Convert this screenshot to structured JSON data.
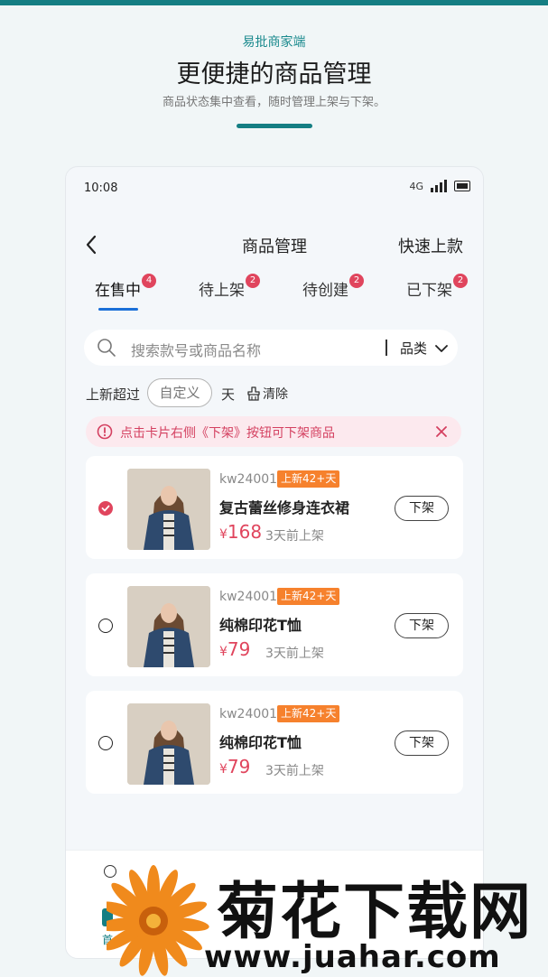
{
  "promo": {
    "brand": "易批商家端",
    "headline": "更便捷的商品管理",
    "subtext": "商品状态集中查看，随时管理上架与下架。"
  },
  "status_bar": {
    "time": "10:08",
    "network": "4G"
  },
  "nav": {
    "title": "商品管理",
    "action": "快速上款",
    "back_icon": "chevron-left-icon"
  },
  "tabs": [
    {
      "label": "在售中",
      "badge": "4",
      "active": true
    },
    {
      "label": "待上架",
      "badge": "2",
      "active": false
    },
    {
      "label": "待创建",
      "badge": "2",
      "active": false
    },
    {
      "label": "已下架",
      "badge": "2",
      "active": false
    }
  ],
  "search": {
    "placeholder": "搜索款号或商品名称",
    "category": "品类"
  },
  "filter": {
    "label": "上新超过",
    "custom": "自定义",
    "unit": "天",
    "clear": "清除"
  },
  "notice": {
    "text": "点击卡片右侧《下架》按钮可下架商品"
  },
  "products": [
    {
      "code": "kw24001",
      "tag": "上新42+天",
      "name": "复古蕾丝修身连衣裙",
      "currency": "¥",
      "price": "168",
      "listed": "3天前上架",
      "action": "下架",
      "checked": true
    },
    {
      "code": "kw24001",
      "tag": "上新42+天",
      "name": "纯棉印花T恤",
      "currency": "¥",
      "price": "79",
      "listed": "3天前上架",
      "action": "下架",
      "checked": false
    },
    {
      "code": "kw24001",
      "tag": "上新42+天",
      "name": "纯棉印花T恤",
      "currency": "¥",
      "price": "79",
      "listed": "3天前上架",
      "action": "下架",
      "checked": false
    }
  ],
  "bottom_nav": {
    "home_label": "首"
  },
  "watermark": {
    "text": "菊花下载网",
    "url": "www.juahar.com"
  },
  "colors": {
    "accent": "#157e83",
    "primary_red": "#e0455d",
    "tag_orange": "#f6812d",
    "tab_blue": "#1a6fd8"
  }
}
